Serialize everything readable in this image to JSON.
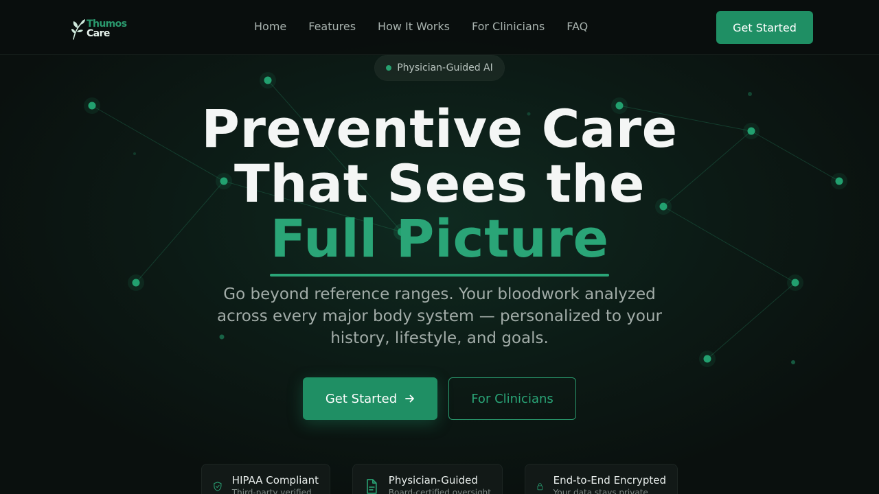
{
  "brand": {
    "name_line1": "Thumos",
    "name_line2": "Care",
    "logo_icon": "leaf-icon"
  },
  "nav": {
    "items": [
      "Home",
      "Features",
      "How It Works",
      "For Clinicians",
      "FAQ"
    ],
    "cta_label": "Get Started"
  },
  "hero": {
    "pill_label": "Physician-Guided AI",
    "headline_line1": "Preventive Care",
    "headline_line2": "That Sees the",
    "headline_accent": "Full Picture",
    "subtitle": "Go beyond reference ranges. Your bloodwork analyzed across every major body system — personalized to your history, lifestyle, and goals.",
    "primary_cta": "Get Started",
    "primary_cta_icon": "arrow-right-icon",
    "secondary_cta": "For Clinicians"
  },
  "badges": [
    {
      "icon": "shield-check-icon",
      "title": "HIPAA Compliant",
      "subtitle": "Third-party verified"
    },
    {
      "icon": "document-icon",
      "title": "Physician-Guided",
      "subtitle": "Board-certified oversight"
    },
    {
      "icon": "lock-icon",
      "title": "End-to-End Encrypted",
      "subtitle": "Your data stays private"
    }
  ],
  "colors": {
    "background": "#0b1110",
    "accent": "#1f8f64",
    "accent_text": "#2aa577",
    "headline": "#f4f6f5",
    "muted_text": "#a2aca8"
  }
}
